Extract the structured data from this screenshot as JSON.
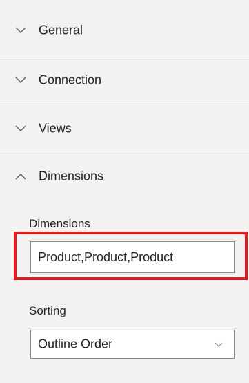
{
  "sections": [
    {
      "label": "General",
      "expanded": false,
      "icon": "chevron-down-icon"
    },
    {
      "label": "Connection",
      "expanded": false,
      "icon": "chevron-down-icon"
    },
    {
      "label": "Views",
      "expanded": false,
      "icon": "chevron-down-icon"
    },
    {
      "label": "Dimensions",
      "expanded": true,
      "icon": "chevron-up-icon"
    }
  ],
  "dimensions_field": {
    "label": "Dimensions",
    "value": "Product,Product,Product"
  },
  "sorting_field": {
    "label": "Sorting",
    "value": "Outline Order",
    "icon": "dropdown-chevron-icon"
  },
  "colors": {
    "panel_bg": "#f3f2f1",
    "highlight": "#e01b22",
    "border": "#8a8886",
    "text": "#252423"
  }
}
